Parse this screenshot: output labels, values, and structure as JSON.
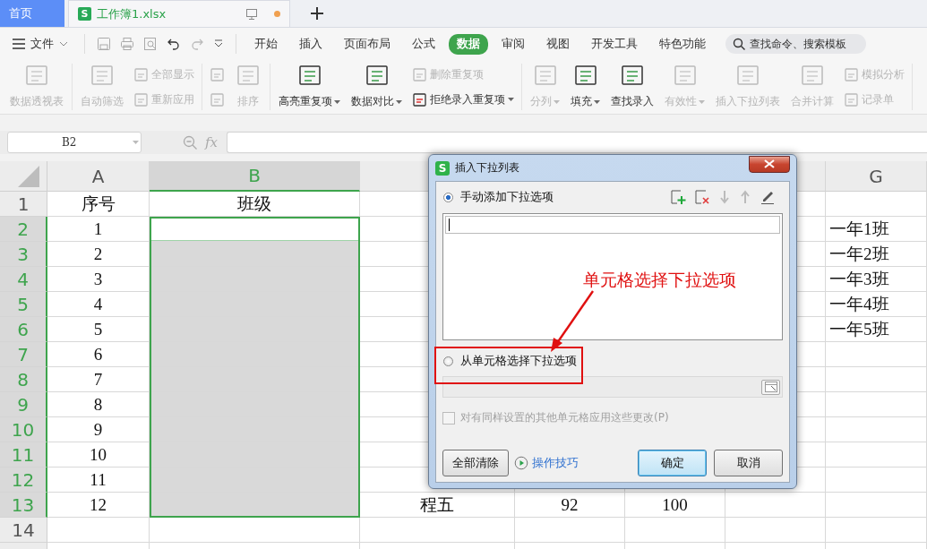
{
  "tabs": [
    {
      "label": "首页",
      "kind": "home",
      "selected": false
    },
    {
      "label": "工作簿1.xlsx",
      "kind": "doc",
      "logo": "S",
      "selected": true,
      "unsaved": true
    }
  ],
  "file_menu": {
    "label": "文件"
  },
  "menu_tabs": [
    {
      "label": "开始",
      "selected": false
    },
    {
      "label": "插入",
      "selected": false
    },
    {
      "label": "页面布局",
      "selected": false
    },
    {
      "label": "公式",
      "selected": false
    },
    {
      "label": "数据",
      "selected": true
    },
    {
      "label": "审阅",
      "selected": false
    },
    {
      "label": "视图",
      "selected": false
    },
    {
      "label": "开发工具",
      "selected": false
    },
    {
      "label": "特色功能",
      "selected": false
    }
  ],
  "search": {
    "placeholder": "查找命令、搜索模板"
  },
  "ribbon": [
    {
      "items": [
        {
          "kind": "large",
          "label": "数据透视表",
          "disabled": true
        }
      ]
    },
    {
      "items": [
        {
          "kind": "large",
          "label": "自动筛选",
          "disabled": true
        },
        {
          "kind": "stack",
          "items": [
            {
              "label": "全部显示",
              "disabled": true
            },
            {
              "label": "重新应用",
              "disabled": true
            }
          ]
        }
      ]
    },
    {
      "items": [
        {
          "kind": "stack",
          "items": [
            {
              "disabled": true
            },
            {
              "disabled": true
            }
          ]
        },
        {
          "kind": "large",
          "label": "排序",
          "disabled": true
        }
      ]
    },
    {
      "items": [
        {
          "kind": "large",
          "label": "高亮重复项",
          "dropdown": true,
          "disabled": false
        },
        {
          "kind": "large",
          "label": "数据对比",
          "dropdown": true,
          "disabled": false
        },
        {
          "kind": "stack",
          "items": [
            {
              "label": "删除重复项",
              "disabled": true
            },
            {
              "label": "拒绝录入重复项",
              "dropdown": true,
              "disabled": false
            }
          ]
        }
      ]
    },
    {
      "items": [
        {
          "kind": "large",
          "label": "分列",
          "dropdown": true,
          "disabled": true
        },
        {
          "kind": "large",
          "label": "填充",
          "dropdown": true,
          "disabled": false
        },
        {
          "kind": "large",
          "label": "查找录入",
          "disabled": false
        },
        {
          "kind": "large",
          "label": "有效性",
          "dropdown": true,
          "disabled": true
        },
        {
          "kind": "large",
          "label": "插入下拉列表",
          "disabled": true
        },
        {
          "kind": "large",
          "label": "合并计算",
          "disabled": true
        },
        {
          "kind": "stack",
          "items": [
            {
              "label": "模拟分析",
              "disabled": true
            },
            {
              "label": "记录单",
              "disabled": true
            }
          ]
        }
      ]
    }
  ],
  "formula_bar": {
    "cell": "B2",
    "fx": "fx"
  },
  "sheet": {
    "columns": [
      {
        "label": "A",
        "selected": false
      },
      {
        "label": "B",
        "selected": true
      },
      {},
      {},
      {},
      {},
      {
        "label": "G",
        "selected": false
      }
    ],
    "rows": [
      {
        "number": "1",
        "selected": false,
        "active": false,
        "cells": [
          {
            "text": "序号"
          },
          {
            "text": "班级"
          },
          {},
          {},
          {},
          {},
          {}
        ]
      },
      {
        "number": "2",
        "selected": true,
        "active": true,
        "cells": [
          {
            "text": "1"
          },
          {},
          {},
          {},
          {},
          {},
          {
            "text": "一年1班"
          }
        ]
      },
      {
        "number": "3",
        "selected": true,
        "active": false,
        "cells": [
          {
            "text": "2"
          },
          {},
          {},
          {},
          {},
          {},
          {
            "text": "一年2班"
          }
        ]
      },
      {
        "number": "4",
        "selected": true,
        "active": false,
        "cells": [
          {
            "text": "3"
          },
          {},
          {},
          {},
          {},
          {},
          {
            "text": "一年3班"
          }
        ]
      },
      {
        "number": "5",
        "selected": true,
        "active": false,
        "cells": [
          {
            "text": "4"
          },
          {},
          {},
          {},
          {},
          {},
          {
            "text": "一年4班"
          }
        ]
      },
      {
        "number": "6",
        "selected": true,
        "active": false,
        "cells": [
          {
            "text": "5"
          },
          {},
          {},
          {},
          {},
          {},
          {
            "text": "一年5班"
          }
        ]
      },
      {
        "number": "7",
        "selected": true,
        "active": false,
        "cells": [
          {
            "text": "6"
          },
          {},
          {},
          {},
          {},
          {},
          {}
        ]
      },
      {
        "number": "8",
        "selected": true,
        "active": false,
        "cells": [
          {
            "text": "7"
          },
          {},
          {},
          {},
          {},
          {},
          {}
        ]
      },
      {
        "number": "9",
        "selected": true,
        "active": false,
        "cells": [
          {
            "text": "8"
          },
          {},
          {},
          {},
          {},
          {},
          {}
        ]
      },
      {
        "number": "10",
        "selected": true,
        "active": false,
        "cells": [
          {
            "text": "9"
          },
          {},
          {},
          {},
          {},
          {},
          {}
        ]
      },
      {
        "number": "11",
        "selected": true,
        "active": false,
        "cells": [
          {
            "text": "10"
          },
          {},
          {},
          {},
          {},
          {},
          {}
        ]
      },
      {
        "number": "12",
        "selected": true,
        "active": false,
        "cells": [
          {
            "text": "11"
          },
          {},
          {},
          {},
          {},
          {},
          {}
        ]
      },
      {
        "number": "13",
        "selected": true,
        "active": false,
        "cells": [
          {
            "text": "12"
          },
          {},
          {
            "text": "程五"
          },
          {
            "text": "92"
          },
          {
            "text": "100"
          },
          {},
          {}
        ]
      },
      {
        "number": "14",
        "selected": false,
        "active": false,
        "cells": [
          {},
          {},
          {},
          {},
          {},
          {},
          {}
        ]
      }
    ]
  },
  "dialog": {
    "logo": "S",
    "title": "插入下拉列表",
    "options": [
      {
        "label": "手动添加下拉选项",
        "selected": true
      },
      {
        "label": "从单元格选择下拉选项",
        "selected": false
      }
    ],
    "apply_all": {
      "label": "对有同样设置的其他单元格应用这些更改(P)",
      "checked": false,
      "disabled": true
    },
    "clear_button": "全部清除",
    "tips_link": "操作技巧",
    "buttons": [
      {
        "label": "确定",
        "default": true
      },
      {
        "label": "取消",
        "default": false
      }
    ],
    "annotation": "单元格选择下拉选项"
  }
}
